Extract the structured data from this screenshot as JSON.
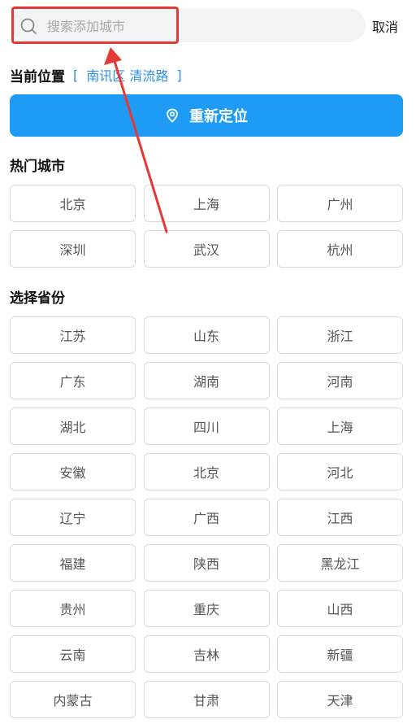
{
  "search": {
    "placeholder": "搜索添加城市",
    "value": ""
  },
  "cancel_label": "取消",
  "location": {
    "title": "当前位置",
    "bracket_open": "[",
    "value": "南讯区 清流路",
    "bracket_close": "]"
  },
  "relocate_label": "重新定位",
  "hot_cities": {
    "title": "热门城市",
    "items": [
      "北京",
      "上海",
      "广州",
      "深圳",
      "武汉",
      "杭州"
    ]
  },
  "provinces": {
    "title": "选择省份",
    "items": [
      "江苏",
      "山东",
      "浙江",
      "广东",
      "湖南",
      "河南",
      "湖北",
      "四川",
      "上海",
      "安徽",
      "北京",
      "河北",
      "辽宁",
      "广西",
      "江西",
      "福建",
      "陕西",
      "黑龙江",
      "贵州",
      "重庆",
      "山西",
      "云南",
      "吉林",
      "新疆",
      "内蒙古",
      "甘肃",
      "天津"
    ]
  },
  "colors": {
    "accent": "#1d9bf5",
    "link": "#2b8fe8",
    "annotation": "#e53935"
  },
  "icons": {
    "search": "search-icon",
    "relocate": "location-pin-icon"
  }
}
